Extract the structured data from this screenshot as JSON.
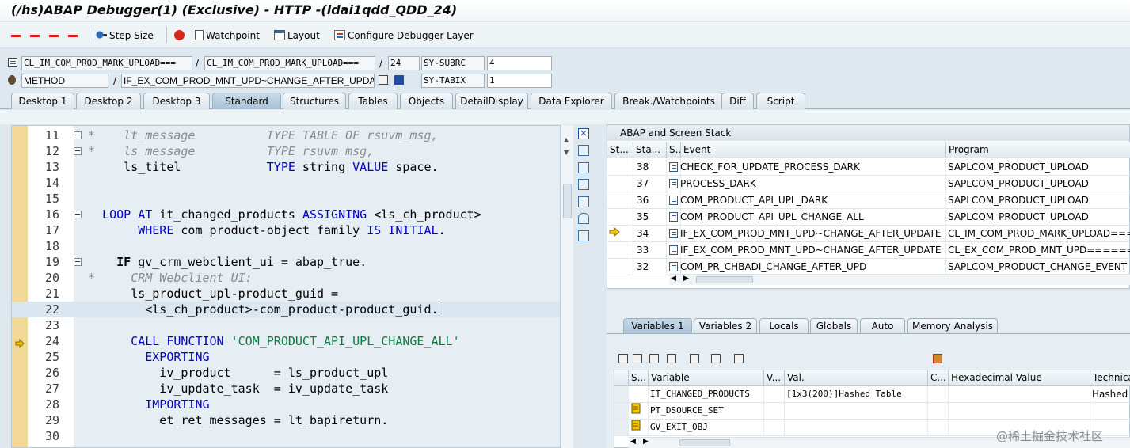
{
  "window": {
    "title": "(/hs)ABAP Debugger(1)  (Exclusive) - HTTP -(ldai1qdd_QDD_24)"
  },
  "toolbar": {
    "step_size": "Step Size",
    "watchpoint": "Watchpoint",
    "layout": "Layout",
    "configure": "Configure Debugger Layer"
  },
  "info": {
    "program": "CL_IM_COM_PROD_MARK_UPLOAD===",
    "include": "CL_IM_COM_PROD_MARK_UPLOAD===",
    "line": "24",
    "subrc_label": "SY-SUBRC",
    "subrc_value": "4",
    "event_type": "METHOD",
    "event": "IF_EX_COM_PROD_MNT_UPD~CHANGE_AFTER_UPDAT",
    "tabix_label": "SY-TABIX",
    "tabix_value": "1",
    "slash": "/"
  },
  "tabs": [
    "Desktop 1",
    "Desktop 2",
    "Desktop 3",
    "Standard",
    "Structures",
    "Tables",
    "Objects",
    "DetailDisplay",
    "Data Explorer",
    "Break./Watchpoints",
    "Diff",
    "Script"
  ],
  "code": {
    "lines": [
      {
        "n": "11",
        "fold": true,
        "parts": [
          [
            "cm",
            "*    lt_message          TYPE TABLE OF rsuvm_msg,"
          ]
        ]
      },
      {
        "n": "12",
        "fold": true,
        "parts": [
          [
            "cm",
            "*    ls_message          TYPE rsuvm_msg,"
          ]
        ]
      },
      {
        "n": "13",
        "parts": [
          [
            "",
            "     ls_titel            "
          ],
          [
            "kw",
            "TYPE"
          ],
          [
            "",
            " string "
          ],
          [
            "kw",
            "VALUE"
          ],
          [
            "",
            " space."
          ]
        ]
      },
      {
        "n": "14",
        "parts": [
          [
            "",
            ""
          ]
        ]
      },
      {
        "n": "15",
        "parts": [
          [
            "",
            ""
          ]
        ]
      },
      {
        "n": "16",
        "fold": true,
        "parts": [
          [
            "kw",
            "  LOOP AT"
          ],
          [
            "",
            " it_changed_products "
          ],
          [
            "kw",
            "ASSIGNING"
          ],
          [
            "",
            " <ls_ch_product>"
          ]
        ]
      },
      {
        "n": "17",
        "parts": [
          [
            "kw",
            "       WHERE"
          ],
          [
            "",
            " com_product-object_family "
          ],
          [
            "kw",
            "IS INITIAL"
          ],
          [
            "",
            "."
          ]
        ]
      },
      {
        "n": "18",
        "parts": [
          [
            "",
            ""
          ]
        ]
      },
      {
        "n": "19",
        "fold": true,
        "parts": [
          [
            "",
            "    "
          ],
          [
            "b",
            "IF"
          ],
          [
            "",
            " gv_crm_webclient_ui = abap_true."
          ]
        ]
      },
      {
        "n": "20",
        "parts": [
          [
            "cm",
            "*     CRM Webclient UI:"
          ]
        ]
      },
      {
        "n": "21",
        "parts": [
          [
            "",
            "      ls_product_upl-product_guid ="
          ]
        ]
      },
      {
        "n": "22",
        "hl": true,
        "parts": [
          [
            "",
            "        <ls_ch_product>-com_product-product_guid."
          ]
        ]
      },
      {
        "n": "23",
        "parts": [
          [
            "",
            ""
          ]
        ]
      },
      {
        "n": "24",
        "arrow": true,
        "parts": [
          [
            "kw",
            "      CALL FUNCTION"
          ],
          [
            "",
            " "
          ],
          [
            "st",
            "'COM_PRODUCT_API_UPL_CHANGE_ALL'"
          ]
        ]
      },
      {
        "n": "25",
        "parts": [
          [
            "kw",
            "        EXPORTING"
          ]
        ]
      },
      {
        "n": "26",
        "parts": [
          [
            "",
            "          iv_product      = ls_product_upl"
          ]
        ]
      },
      {
        "n": "27",
        "parts": [
          [
            "",
            "          iv_update_task  = iv_update_task"
          ]
        ]
      },
      {
        "n": "28",
        "parts": [
          [
            "kw",
            "        IMPORTING"
          ]
        ]
      },
      {
        "n": "29",
        "parts": [
          [
            "",
            "          et_ret_messages = lt_bapireturn."
          ]
        ]
      },
      {
        "n": "30",
        "parts": [
          [
            "",
            ""
          ]
        ]
      }
    ]
  },
  "stack": {
    "title": "ABAP and Screen Stack",
    "headers": [
      "St...",
      "Sta...",
      "S...",
      "Event",
      "Program"
    ],
    "rows": [
      {
        "level": "38",
        "event": "CHECK_FOR_UPDATE_PROCESS_DARK",
        "program": "SAPLCOM_PRODUCT_UPLOAD"
      },
      {
        "level": "37",
        "event": "PROCESS_DARK",
        "program": "SAPLCOM_PRODUCT_UPLOAD"
      },
      {
        "level": "36",
        "event": "COM_PRODUCT_API_UPL_DARK",
        "program": "SAPLCOM_PRODUCT_UPLOAD"
      },
      {
        "level": "35",
        "event": "COM_PRODUCT_API_UPL_CHANGE_ALL",
        "program": "SAPLCOM_PRODUCT_UPLOAD"
      },
      {
        "level": "34",
        "event": "IF_EX_COM_PROD_MNT_UPD~CHANGE_AFTER_UPDATE",
        "program": "CL_IM_COM_PROD_MARK_UPLOAD====",
        "current": true
      },
      {
        "level": "33",
        "event": "IF_EX_COM_PROD_MNT_UPD~CHANGE_AFTER_UPDATE",
        "program": "CL_EX_COM_PROD_MNT_UPD========"
      },
      {
        "level": "32",
        "event": "COM_PR_CHBADI_CHANGE_AFTER_UPD",
        "program": "SAPLCOM_PRODUCT_CHANGE_EVENT"
      }
    ]
  },
  "var_tabs": [
    "Variables 1",
    "Variables 2",
    "Locals",
    "Globals",
    "Auto",
    "Memory Analysis"
  ],
  "vars": {
    "headers": [
      "S...",
      "Variable",
      "V...",
      "Val.",
      "C...",
      "Hexadecimal Value",
      "Technica"
    ],
    "rows": [
      {
        "name": "IT_CHANGED_PRODUCTS",
        "value": "[1x3(200)]Hashed Table",
        "tech": "Hashed T"
      },
      {
        "name": "PT_DSOURCE_SET",
        "value": "",
        "tech": "",
        "icon": true
      },
      {
        "name": "GV_EXIT_OBJ",
        "value": "",
        "tech": "",
        "icon": true
      }
    ]
  },
  "watermark": "@稀土掘金技术社区",
  "colors": {
    "keyword": "#0000c8",
    "comment": "#8a8a8a",
    "string": "#0b7a3e",
    "gutter": "#f2d99a",
    "accent": "#a9c2d6"
  }
}
